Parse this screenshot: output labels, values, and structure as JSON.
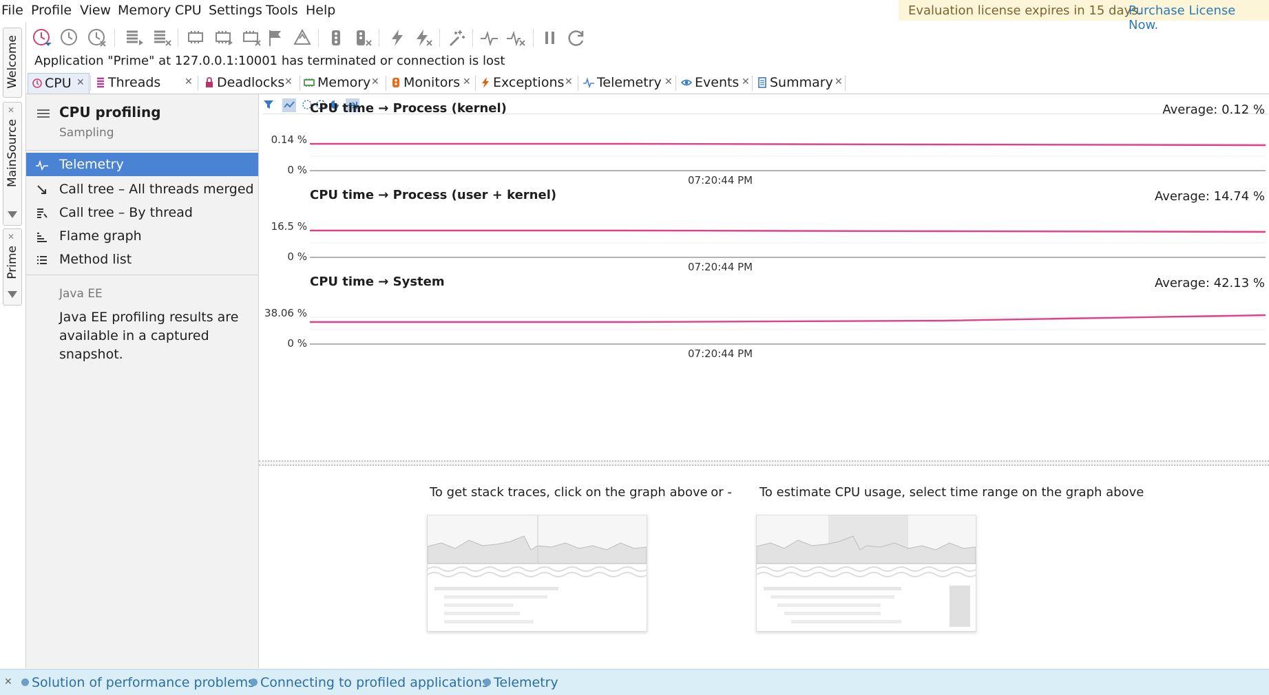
{
  "menubar": {
    "items": [
      "File",
      "Profile",
      "View",
      "Memory",
      "CPU",
      "Settings",
      "Tools",
      "Help"
    ]
  },
  "license": {
    "notice": "Evaluation license expires in 15 days.",
    "purchase_link": "Purchase License Now."
  },
  "side_tabs": {
    "welcome": "Welcome",
    "mainsource": "MainSource",
    "prime": "Prime"
  },
  "status_message": "Application \"Prime\" at 127.0.0.1:10001 has terminated or connection is lost",
  "tabs": [
    {
      "label": "CPU",
      "icon": "clock-icon",
      "color": "#d04070",
      "active": true
    },
    {
      "label": "Threads",
      "icon": "threads-icon",
      "color": "#b04090"
    },
    {
      "label": "Deadlocks",
      "icon": "lock-icon",
      "color": "#c0306a"
    },
    {
      "label": "Memory",
      "icon": "memory-chip-icon",
      "color": "#3a8a3a"
    },
    {
      "label": "Monitors",
      "icon": "monitor-icon",
      "color": "#e07020"
    },
    {
      "label": "Exceptions",
      "icon": "lightning-icon",
      "color": "#e06010"
    },
    {
      "label": "Telemetry",
      "icon": "pulse-icon",
      "color": "#4a82d4"
    },
    {
      "label": "Events",
      "icon": "eye-icon",
      "color": "#3a78c0"
    },
    {
      "label": "Summary",
      "icon": "document-icon",
      "color": "#3a78c0"
    }
  ],
  "nav": {
    "title": "CPU profiling",
    "subtitle": "Sampling",
    "items": [
      {
        "label": "Telemetry",
        "icon": "pulse-icon",
        "selected": true
      },
      {
        "label": "Call tree – All threads merged",
        "icon": "call-tree-merged-icon"
      },
      {
        "label": "Call tree – By thread",
        "icon": "call-tree-thread-icon"
      },
      {
        "label": "Flame graph",
        "icon": "flame-graph-icon"
      },
      {
        "label": "Method list",
        "icon": "list-icon"
      }
    ],
    "section_label": "Java EE",
    "section_note": "Java EE profiling results are available in a captured snapshot."
  },
  "charts": [
    {
      "title": "CPU time → Process (kernel)",
      "average": "Average: 0.12 %",
      "y_max_label": "0.14 %",
      "y_min_label": "0 %",
      "x_label": "07:20:44 PM"
    },
    {
      "title": "CPU time → Process (user + kernel)",
      "average": "Average: 14.74 %",
      "y_max_label": "16.5 %",
      "y_min_label": "0 %",
      "x_label": "07:20:44 PM"
    },
    {
      "title": "CPU time → System",
      "average": "Average: 42.13 %",
      "y_max_label": "38.06 %",
      "y_min_label": "0 %",
      "x_label": "07:20:44 PM"
    }
  ],
  "hints": {
    "stack_traces": "To get stack traces, click on the graph above",
    "or": "- or -",
    "estimate": "To estimate CPU usage, select time range on the graph above"
  },
  "help_links": [
    "Solution of performance problems",
    "Connecting to profiled applications",
    "Telemetry"
  ],
  "colors": {
    "series_line": "#e0408a",
    "selection": "#4a82d4",
    "license_bg": "#fdf5d8",
    "help_bg": "#daeef7"
  }
}
